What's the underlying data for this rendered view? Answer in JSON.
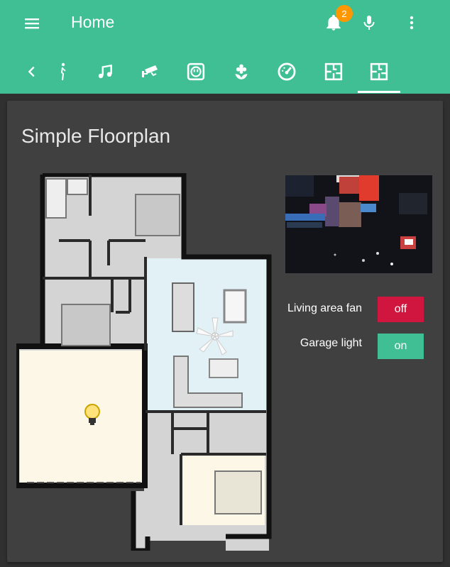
{
  "header": {
    "title": "Home",
    "notification_count": "2",
    "accent_color": "#3fbf93",
    "badge_color": "#ff9800",
    "icons": [
      "menu-icon",
      "bell-icon",
      "microphone-icon",
      "more-vert-icon"
    ]
  },
  "tabs": {
    "items": [
      {
        "icon": "chevron-left-icon"
      },
      {
        "icon": "person-icon"
      },
      {
        "icon": "music-icon"
      },
      {
        "icon": "cctv-icon"
      },
      {
        "icon": "power-socket-icon"
      },
      {
        "icon": "flower-icon"
      },
      {
        "icon": "speedometer-icon"
      },
      {
        "icon": "floorplan-icon"
      },
      {
        "icon": "floorplan-icon"
      }
    ],
    "active_index": 8
  },
  "card": {
    "title": "Simple Floorplan",
    "entities": [
      {
        "label": "Living area fan",
        "state": "off",
        "color": "#d0163f"
      },
      {
        "label": "Garage light",
        "state": "on",
        "color": "#3fbf93"
      }
    ]
  }
}
